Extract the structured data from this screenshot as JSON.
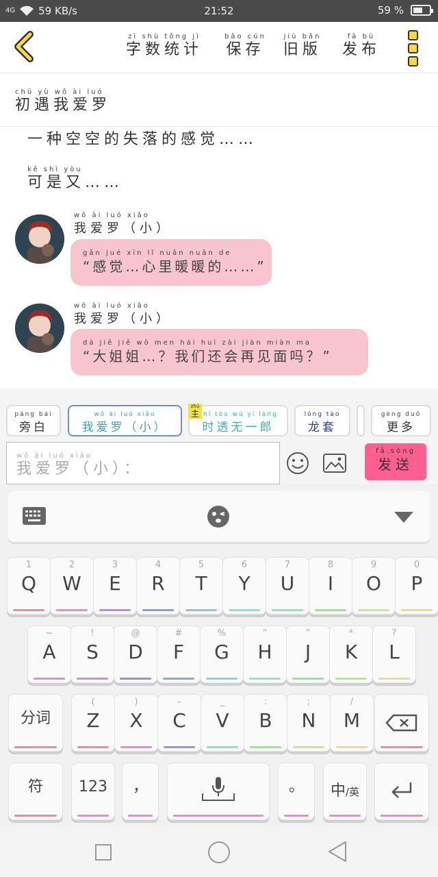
{
  "status": {
    "network": "4G",
    "speed": "59 KB/s",
    "time": "21:52",
    "battery_text": "59 %",
    "battery_level": 0.59
  },
  "header": {
    "buttons": [
      {
        "pinyin": "zì shù tǒng jì",
        "label": "字数统计"
      },
      {
        "pinyin": "bǎo cún",
        "label": "保存"
      },
      {
        "pinyin": "jiù bǎn",
        "label": "旧版"
      },
      {
        "pinyin": "fā bù",
        "label": "发布"
      }
    ]
  },
  "title": {
    "pinyin": "chū yù wǒ ài luó",
    "text": "初遇我爱罗"
  },
  "story": {
    "line1": "一种空空的失落的感觉……",
    "line2_pinyin": "kě shì yòu",
    "line2": "可是又……"
  },
  "messages": [
    {
      "name_pinyin": "wǒ ài luó    xiǎo",
      "name": "我爱罗（小）",
      "pinyin": "gǎn jué      xīn  lǐ  nuǎn nuǎn  de",
      "text": "“感觉…心里暖暖的……”"
    },
    {
      "name_pinyin": "wǒ ài luó    xiǎo",
      "name": "我爱罗（小）",
      "pinyin": "dà  jiě  jiě       wǒ men hái huì zài jiàn miàn ma",
      "text": "“大姐姐…？我们还会再见面吗？”"
    }
  ],
  "chips": [
    {
      "pinyin": "páng bái",
      "label": "旁白"
    },
    {
      "pinyin": "wǒ ài luó  xiǎo",
      "label": "我爱罗（小）"
    },
    {
      "badge": "主",
      "badge_pinyin": "zhǔ",
      "pinyin": "shí tòu wú yī láng",
      "label": "时透无一郎"
    },
    {
      "pinyin": "lóng tào",
      "label": "龙套"
    },
    {
      "pinyin": "gèng duō",
      "label": "更多"
    }
  ],
  "input": {
    "pinyin": "wǒ ài luó   xiǎo",
    "placeholder": "我爱罗（小）："
  },
  "send": {
    "pinyin": "fā sòng",
    "label": "发送"
  },
  "keyboard": {
    "row1": [
      {
        "sub": "1",
        "label": "Q",
        "color": "#f08a9a"
      },
      {
        "sub": "2",
        "label": "W",
        "color": "#e98ad6"
      },
      {
        "sub": "3",
        "label": "E",
        "color": "#b58ae9"
      },
      {
        "sub": "4",
        "label": "R",
        "color": "#8a9ae9"
      },
      {
        "sub": "5",
        "label": "T",
        "color": "#8ac3e9"
      },
      {
        "sub": "6",
        "label": "Y",
        "color": "#8ae0e9"
      },
      {
        "sub": "7",
        "label": "U",
        "color": "#8ae9b4"
      },
      {
        "sub": "8",
        "label": "I",
        "color": "#97e98a"
      },
      {
        "sub": "9",
        "label": "O",
        "color": "#c6e98a"
      },
      {
        "sub": "0",
        "label": "P",
        "color": "#e9e08a"
      }
    ],
    "row2": [
      {
        "sub": "~",
        "label": "A",
        "color": "#e98ad6"
      },
      {
        "sub": "!",
        "label": "S",
        "color": "#c98ae9"
      },
      {
        "sub": "@",
        "label": "D",
        "color": "#9a8ae9"
      },
      {
        "sub": "#",
        "label": "F",
        "color": "#8aa6e9"
      },
      {
        "sub": "%",
        "label": "G",
        "color": "#8ad0e9"
      },
      {
        "sub": "“",
        "label": "H",
        "color": "#8ae9c0"
      },
      {
        "sub": "”",
        "label": "J",
        "color": "#8ae99a"
      },
      {
        "sub": "*",
        "label": "K",
        "color": "#b4e98a"
      },
      {
        "sub": "?",
        "label": "L",
        "color": "#e9e08a"
      }
    ],
    "row3": [
      {
        "sub": "(",
        "label": "Z",
        "color": "#f08a9a"
      },
      {
        "sub": ")",
        "label": "X",
        "color": "#e98ad6"
      },
      {
        "sub": "–",
        "label": "C",
        "color": "#8a9ae9"
      },
      {
        "sub": "_",
        "label": "V",
        "color": "#8ae9a6"
      },
      {
        "sub": ":",
        "label": "B",
        "color": "#97e98a"
      },
      {
        "sub": ";",
        "label": "N",
        "color": "#c6e98a"
      },
      {
        "sub": "/",
        "label": "M",
        "color": "#e9e08a"
      }
    ],
    "fenci": "分词",
    "fu": "符",
    "num": "123",
    "comma": "，",
    "period": "。",
    "lang_main": "中",
    "lang_sub": "/英"
  }
}
